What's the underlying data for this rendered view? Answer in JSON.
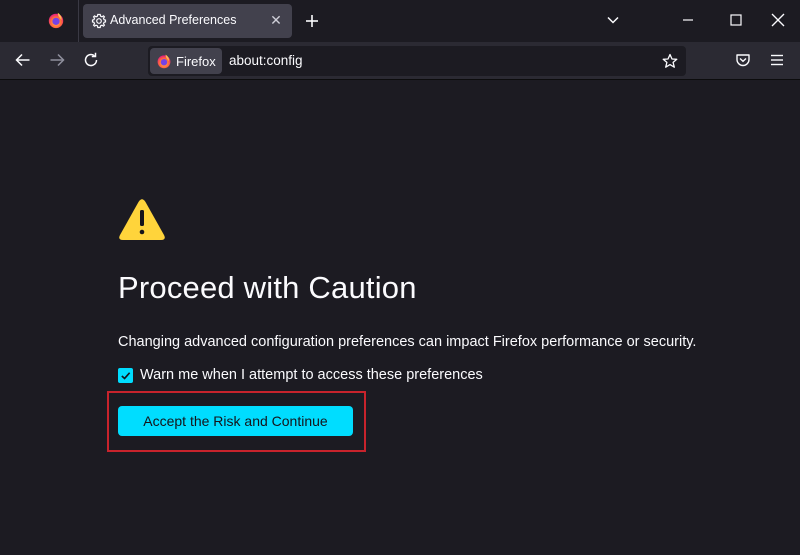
{
  "browser": {
    "tab": {
      "title": "Advanced Preferences",
      "icon": "gear-icon"
    },
    "window_controls": [
      "minimize",
      "maximize",
      "close"
    ],
    "navbar": {
      "identity_label": "Firefox",
      "url": "about:config"
    }
  },
  "page": {
    "title": "Proceed with Caution",
    "description": "Changing advanced configuration preferences can impact Firefox performance or security.",
    "checkbox": {
      "label": "Warn me when I attempt to access these preferences",
      "checked": true
    },
    "accept_button_label": "Accept the Risk and Continue"
  },
  "colors": {
    "accent": "#00ddff",
    "warning": "#ffd43b",
    "highlight_border": "#c8232c",
    "background": "#1c1b22",
    "toolbar": "#2b2a33"
  }
}
